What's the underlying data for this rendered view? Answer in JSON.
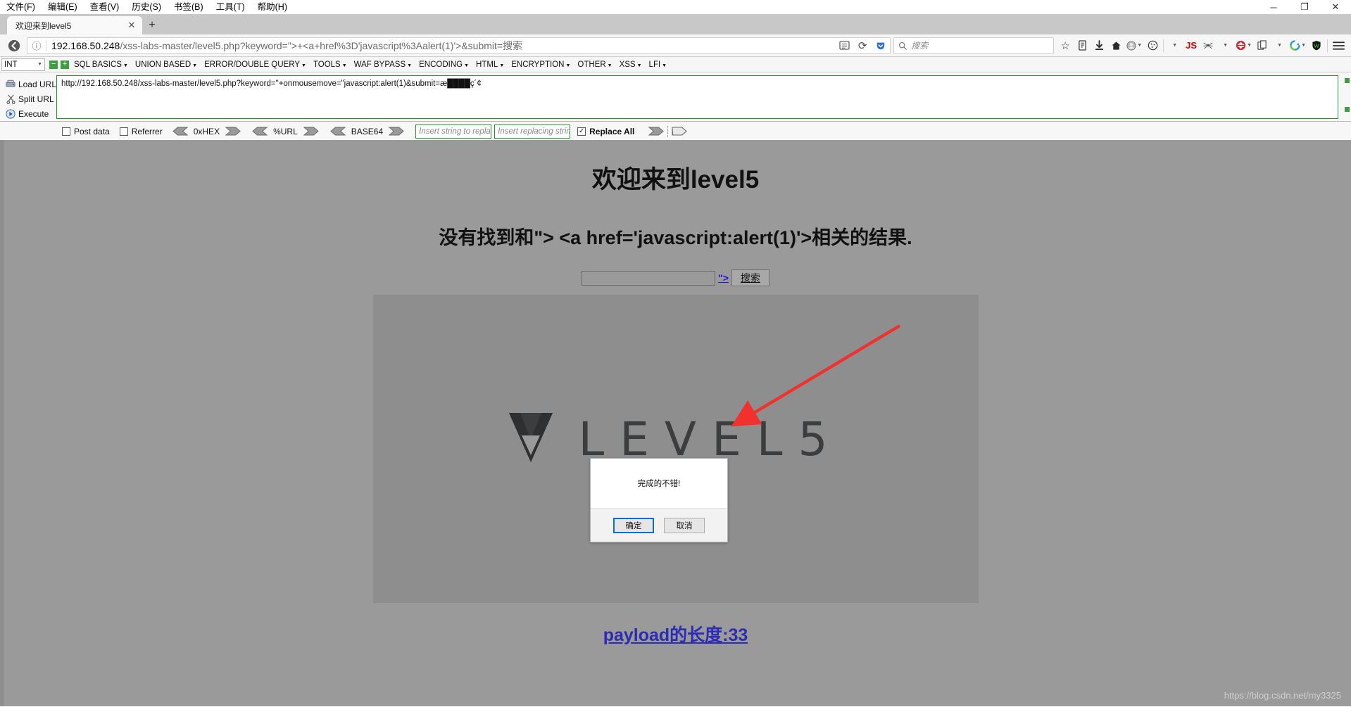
{
  "window": {
    "menus": [
      {
        "label": "文件(F)",
        "accel": "F"
      },
      {
        "label": "编辑(E)",
        "accel": "E"
      },
      {
        "label": "查看(V)",
        "accel": "V"
      },
      {
        "label": "历史(S)",
        "accel": "S"
      },
      {
        "label": "书签(B)",
        "accel": "B"
      },
      {
        "label": "工具(T)",
        "accel": "T"
      },
      {
        "label": "帮助(H)",
        "accel": "H"
      }
    ],
    "controls": {
      "minimize": "─",
      "maximize": "❐",
      "close": "✕"
    }
  },
  "tabs": {
    "items": [
      {
        "label": "欢迎来到level5",
        "close": "✕"
      }
    ],
    "new_tab": "+"
  },
  "navbar": {
    "back": "←",
    "forward": "→",
    "reload": "⟳",
    "identity_icon": "ⓘ",
    "url_host": "192.168.50.248",
    "url_path": "/xss-labs-master/level5.php?keyword=\">+<a+href%3D'javascript%3Aalert(1)'>&submit=搜索",
    "reader_icon": "reader-mode-icon",
    "pocket_icon": "pocket-icon",
    "search_placeholder": "搜索",
    "bookmark_star": "☆",
    "library_icon": "library-icon",
    "downloads_icon": "⬇",
    "home_icon": "home-icon",
    "account_icon": "account-icon",
    "cookie_icon": "cookie-icon",
    "js_label": "JS",
    "spider_icon": "spider-icon",
    "hackbar_icon": "hackbar-icon",
    "page_icon": "page-copy-icon",
    "proxy_icon": "proxy-swap-icon",
    "shield_label": "W",
    "menu_icon": "hamburger-menu-icon"
  },
  "bookmarks": {
    "mode": "INT",
    "minus": "−",
    "plus": "+",
    "items": [
      "SQL BASICS",
      "UNION BASED",
      "ERROR/DOUBLE QUERY",
      "TOOLS",
      "WAF BYPASS",
      "ENCODING",
      "HTML",
      "ENCRYPTION",
      "OTHER",
      "XSS",
      "LFI"
    ]
  },
  "hackbar": {
    "load_url": "Load URL",
    "split_url": "Split URL",
    "execute": "Execute",
    "url_value": "http://192.168.50.248/xss-labs-master/level5.php?keyword=\"+onmousemove=\"javascript:alert(1)&submit=æ████ç´¢",
    "post_data_label": "Post data",
    "post_data_checked": false,
    "referrer_label": "Referrer",
    "referrer_checked": false,
    "encoders": [
      "0xHEX",
      "%URL",
      "BASE64"
    ],
    "replace_from_placeholder": "Insert string to replace",
    "replace_to_placeholder": "Insert replacing string",
    "replace_all_label": "Replace All",
    "replace_all_checked": true
  },
  "page": {
    "heading": "欢迎来到level5",
    "subheading": "没有找到和\"> <a href='javascript:alert(1)'>相关的结果.",
    "input_value": "",
    "inline_link": "\">",
    "submit_label": "搜索",
    "logo_text": "LEVEL5",
    "payload_link": "payload的长度:33",
    "watermark": "https://blog.csdn.net/my3325"
  },
  "dialog": {
    "message": "完成的不错!",
    "ok_label": "确定",
    "cancel_label": "取消"
  },
  "colors": {
    "page_bg": "#9a9a9a",
    "image_bg": "#8e8e8e",
    "link": "#2b2bb5",
    "hackbar_border": "#2d8f2d",
    "accent_blue": "#0b6fd4",
    "arrow_red": "#f0312e"
  }
}
